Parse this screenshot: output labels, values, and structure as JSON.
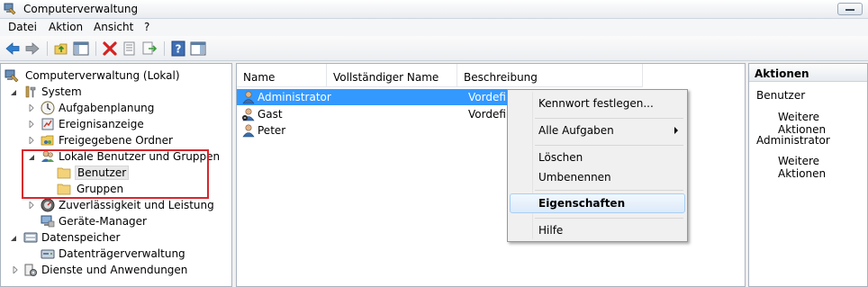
{
  "window": {
    "title": "Computerverwaltung"
  },
  "menu": [
    "Datei",
    "Aktion",
    "Ansicht",
    "?"
  ],
  "toolbar": {
    "icons": [
      "back-arrow-icon",
      "forward-arrow-icon",
      "up-folder-icon",
      "show-hide-tree-icon",
      "delete-icon",
      "properties-icon",
      "export-icon",
      "help-icon",
      "show-hide-action-pane-icon"
    ]
  },
  "tree": {
    "root": "Computerverwaltung (Lokal)",
    "system": "System",
    "aufgabenplanung": "Aufgabenplanung",
    "ereignisanzeige": "Ereignisanzeige",
    "freigegebene_ordner": "Freigegebene Ordner",
    "lokale_benutzer": "Lokale Benutzer und Gruppen",
    "benutzer": "Benutzer",
    "gruppen": "Gruppen",
    "zuverlaessigkeit": "Zuverlässigkeit und Leistung",
    "geraete_manager": "Geräte-Manager",
    "datenspeicher": "Datenspeicher",
    "datentraeger": "Datenträgerverwaltung",
    "dienste": "Dienste und Anwendungen"
  },
  "list": {
    "columns": [
      "Name",
      "Vollständiger Name",
      "Beschreibung"
    ],
    "rows": [
      {
        "name": "Administrator",
        "fullname": "",
        "desc": "Vordefin"
      },
      {
        "name": "Gast",
        "fullname": "",
        "desc": "Vordefin"
      },
      {
        "name": "Peter",
        "fullname": "",
        "desc": ""
      }
    ]
  },
  "context_menu": {
    "kennwort": "Kennwort festlegen...",
    "alle_aufgaben": "Alle Aufgaben",
    "loeschen": "Löschen",
    "umbenennen": "Umbenennen",
    "eigenschaften": "Eigenschaften",
    "hilfe": "Hilfe"
  },
  "actions": {
    "header": "Aktionen",
    "section1": "Benutzer",
    "more1": "Weitere Aktionen",
    "section2": "Administrator",
    "more2": "Weitere Aktionen"
  },
  "colors": {
    "selection": "#3399ff",
    "highlight_box": "#d8262c"
  }
}
